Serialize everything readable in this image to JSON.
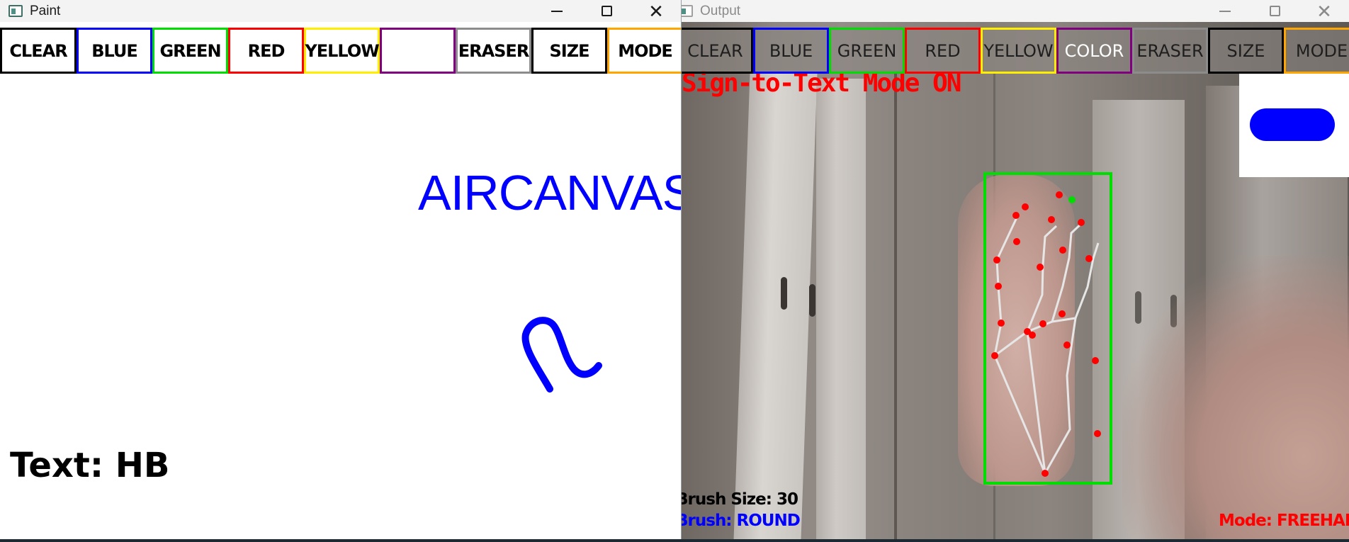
{
  "paint_window": {
    "title": "Paint",
    "toolbar": [
      {
        "label": "CLEAR",
        "border": "#000000"
      },
      {
        "label": "BLUE",
        "border": "#0000ff"
      },
      {
        "label": "GREEN",
        "border": "#00dd00"
      },
      {
        "label": "RED",
        "border": "#ff0000"
      },
      {
        "label": "YELLOW",
        "border": "#ffee00"
      },
      {
        "label": "",
        "border": "#800080"
      },
      {
        "label": "ERASER",
        "border": "#8c8c8c"
      },
      {
        "label": "SIZE",
        "border": "#000000"
      },
      {
        "label": "MODE",
        "border": "#ffa500"
      }
    ],
    "canvas_word": "AIRCANVAS",
    "text_label": "Text:",
    "text_value": "HB"
  },
  "output_window": {
    "title": "Output",
    "toolbar": [
      {
        "label": "CLEAR",
        "border": "#000000"
      },
      {
        "label": "BLUE",
        "border": "#0000ff"
      },
      {
        "label": "GREEN",
        "border": "#00dd00"
      },
      {
        "label": "RED",
        "border": "#ff0000"
      },
      {
        "label": "YELLOW",
        "border": "#ffee00"
      },
      {
        "label": "COLOR",
        "border": "#800080"
      },
      {
        "label": "ERASER",
        "border": "#8c8c8c"
      },
      {
        "label": "SIZE",
        "border": "#000000"
      },
      {
        "label": "MODE",
        "border": "#ffa500"
      }
    ],
    "mode_banner": "Sign-to-Text Mode ON",
    "brush_size_label": "Brush Size: 30",
    "brush_type_label": "Brush: ROUND",
    "mode_label": "Mode: FREEHAN",
    "brush_color": "#0000ff",
    "landmark_color": "#ff0000",
    "index_tip_color": "#00dd00",
    "bbox_color": "#00dd00"
  }
}
